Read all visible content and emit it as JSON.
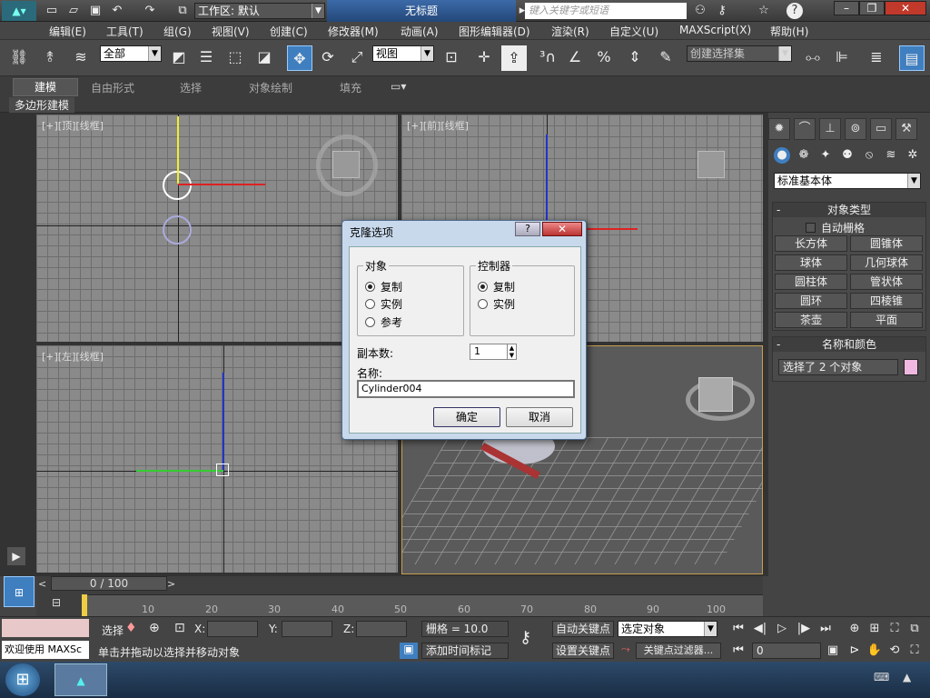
{
  "app": {
    "title": "无标题",
    "workspace": "工作区: 默认",
    "search_placeholder": "键入关键字或短语"
  },
  "menu": [
    "编辑(E)",
    "工具(T)",
    "组(G)",
    "视图(V)",
    "创建(C)",
    "修改器(M)",
    "动画(A)",
    "图形编辑器(D)",
    "渲染(R)",
    "自定义(U)",
    "MAXScript(X)",
    "帮助(H)"
  ],
  "toolbar": {
    "filter": "全部",
    "ref_coord": "视图",
    "named_selection": "创建选择集"
  },
  "ribbon": {
    "tabs": [
      "建模",
      "自由形式",
      "选择",
      "对象绘制",
      "填充"
    ],
    "sub": "多边形建模"
  },
  "viewports": {
    "top": "[+][顶][线框]",
    "front": "[+][前][线框]",
    "left": "[+][左][线框]"
  },
  "dialog": {
    "title": "克隆选项",
    "object_group": "对象",
    "object_options": [
      "复制",
      "实例",
      "参考"
    ],
    "controller_group": "控制器",
    "controller_options": [
      "复制",
      "实例"
    ],
    "copies_label": "副本数:",
    "copies_value": "1",
    "name_label": "名称:",
    "name_value": "Cylinder004",
    "ok": "确定",
    "cancel": "取消"
  },
  "cmd": {
    "category": "标准基本体",
    "object_type_title": "对象类型",
    "autogrid": "自动栅格",
    "objects": [
      "长方体",
      "圆锥体",
      "球体",
      "几何球体",
      "圆柱体",
      "管状体",
      "圆环",
      "四棱锥",
      "茶壶",
      "平面"
    ],
    "name_color_title": "名称和颜色",
    "selected_text": "选择了 2 个对象",
    "swatch_color": "#f0b8e0"
  },
  "timeline": {
    "frame": "0 / 100",
    "ticks": [
      "0",
      "10",
      "20",
      "30",
      "40",
      "50",
      "60",
      "70",
      "80",
      "90",
      "100"
    ]
  },
  "status": {
    "welcome": "欢迎使用 MAXSc",
    "select_label": "选择",
    "x_label": "X:",
    "y_label": "Y:",
    "z_label": "Z:",
    "grid": "栅格 = 10.0",
    "auto_key": "自动关键点",
    "selected_object": "选定对象",
    "set_key": "设置关键点",
    "key_filter": "关键点过滤器...",
    "frame_value": "0",
    "prompt": "单击并拖动以选择并移动对象",
    "add_time_tag": "添加时间标记"
  }
}
